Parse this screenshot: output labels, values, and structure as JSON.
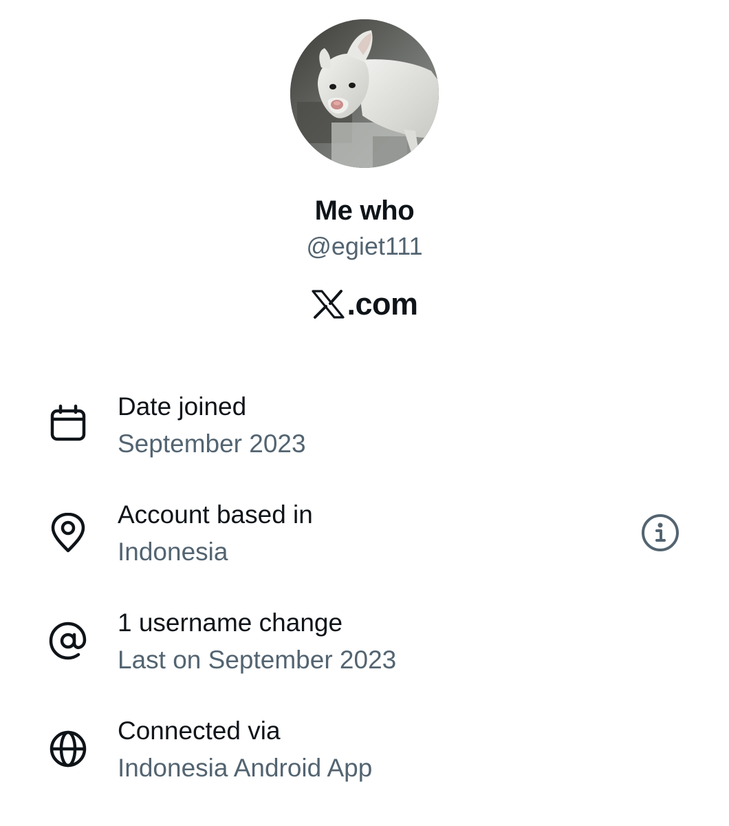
{
  "profile": {
    "display_name": "Me who",
    "handle": "@egiet111",
    "avatar_description": "white dog profile photo"
  },
  "brand": {
    "logo_icon": "x-logo-icon",
    "suffix": ".com"
  },
  "rows": [
    {
      "icon": "calendar-icon",
      "title": "Date joined",
      "subtitle": "September 2023"
    },
    {
      "icon": "location-pin-icon",
      "title": "Account based in",
      "subtitle": "Indonesia",
      "action_icon": "info-icon"
    },
    {
      "icon": "at-sign-icon",
      "title": "1 username change",
      "subtitle": "Last on September 2023"
    },
    {
      "icon": "globe-icon",
      "title": "Connected via",
      "subtitle": "Indonesia Android App"
    }
  ],
  "colors": {
    "primary_text": "#0f1419",
    "secondary_text": "#536471",
    "background": "#ffffff"
  }
}
